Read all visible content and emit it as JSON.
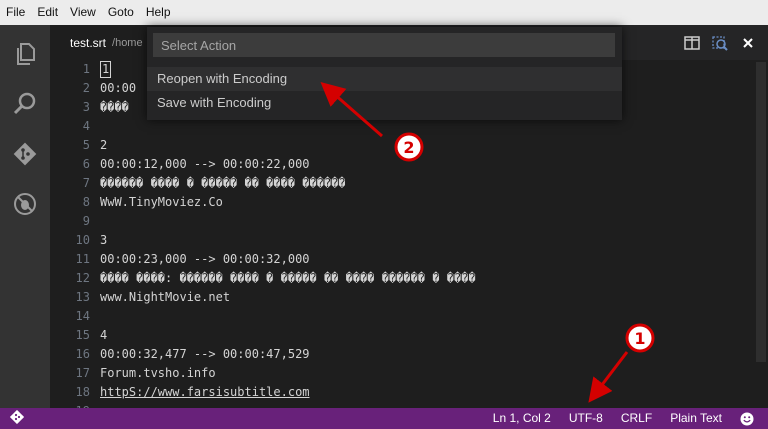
{
  "menu": [
    "File",
    "Edit",
    "View",
    "Goto",
    "Help"
  ],
  "activity_icons": [
    "explorer-icon",
    "search-icon",
    "git-icon",
    "debug-icon"
  ],
  "tab": {
    "name": "test.srt",
    "path": "/home"
  },
  "palette": {
    "placeholder": "Select Action",
    "items": [
      "Reopen with Encoding",
      "Save with Encoding"
    ]
  },
  "editor": {
    "lines": [
      {
        "n": "1",
        "text": "1"
      },
      {
        "n": "2",
        "text": "00:00"
      },
      {
        "n": "3",
        "text": "����"
      },
      {
        "n": "4",
        "text": ""
      },
      {
        "n": "5",
        "text": "2"
      },
      {
        "n": "6",
        "text": "00:00:12,000 --> 00:00:22,000"
      },
      {
        "n": "7",
        "text": "������ ���� � ����� �� ���� ������"
      },
      {
        "n": "8",
        "text": "WwW.TinyMoviez.Co"
      },
      {
        "n": "9",
        "text": ""
      },
      {
        "n": "10",
        "text": "3"
      },
      {
        "n": "11",
        "text": "00:00:23,000 --> 00:00:32,000"
      },
      {
        "n": "12",
        "text": "���� ����: ������ ���� � ����� �� ���� ������ � ����"
      },
      {
        "n": "13",
        "text": "www.NightMovie.net"
      },
      {
        "n": "14",
        "text": ""
      },
      {
        "n": "15",
        "text": "4"
      },
      {
        "n": "16",
        "text": "00:00:32,477 --> 00:00:47,529"
      },
      {
        "n": "17",
        "text": "Forum.tvsho.info"
      },
      {
        "n": "18",
        "text": "httpS://www.farsisubtitle.com"
      },
      {
        "n": "19",
        "text": ""
      }
    ]
  },
  "status": {
    "position": "Ln 1, Col 2",
    "encoding": "UTF-8",
    "eol": "CRLF",
    "language": "Plain Text"
  },
  "annotations": {
    "badge1": "1",
    "badge2": "2"
  },
  "colors": {
    "statusbar": "#68217a",
    "annotation": "#d40000"
  }
}
